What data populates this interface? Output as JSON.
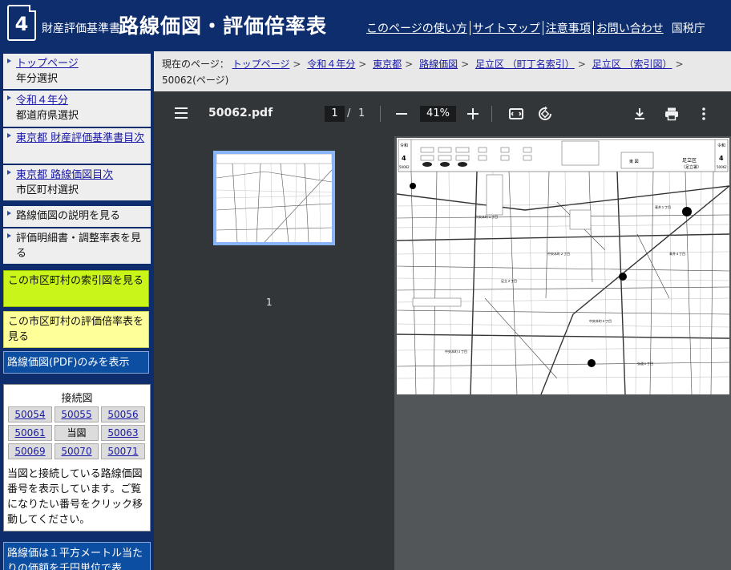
{
  "header": {
    "logo_number": "4",
    "subtitle": "財産評価基準書",
    "title": "路線価図・評価倍率表",
    "nav": [
      "このページの使い方",
      "サイトマップ",
      "注意事項",
      "お問い合わせ"
    ],
    "agency": "国税庁"
  },
  "sidebar": {
    "items": [
      {
        "link": "トップページ",
        "sub": "年分選択"
      },
      {
        "link": "令和４年分",
        "sub": "都道府県選択"
      },
      {
        "link": "東京都 財産評価基準書目次",
        "sub": ""
      },
      {
        "link": "東京都 路線価図目次",
        "sub": "市区町村選択"
      },
      {
        "text": "路線価図の説明を見る"
      },
      {
        "text": "評価明細書・調整率表を見る"
      }
    ],
    "index_map": "この市区町村の索引図を見る",
    "rate_table": "この市区町村の評価倍率表を見る",
    "pdf_only": "路線価図(PDF)のみを表示",
    "connect": {
      "title": "接続図",
      "cells": [
        "50054",
        "50055",
        "50056",
        "50061",
        "当図",
        "50063",
        "50069",
        "50070",
        "50071"
      ],
      "description": "当図と接続している路線価図番号を表示しています。ご覧になりたい番号をクリック移動してください。"
    },
    "bottom_note": "路線価は１平方メートル当たりの価額を千円単位で表"
  },
  "breadcrumb": {
    "label": "現在のページ：",
    "items": [
      "トップページ",
      "令和４年分",
      "東京都",
      "路線価図",
      "足立区 （町丁名索引）",
      "足立区 （索引図）"
    ],
    "current": "50062(ページ)"
  },
  "viewer": {
    "filename": "50062.pdf",
    "current_page": "1",
    "page_sep": "/",
    "total_pages": "1",
    "zoom": "41%",
    "thumbnail_label": "1",
    "icons": [
      "menu-icon",
      "zoom-out-icon",
      "zoom-in-icon",
      "fit-page-icon",
      "rotate-icon",
      "download-icon",
      "print-icon",
      "more-vert-icon"
    ]
  },
  "map": {
    "left_label_top": "令和",
    "left_label_num": "4",
    "left_label_code": "50062",
    "right_label_top": "令和",
    "right_label_num": "4",
    "right_label_code": "50062",
    "ward": "足立区",
    "ward_sub": "（足立署）",
    "direction_box": "東 図",
    "areas": [
      "中央本町１丁目",
      "中央本町２丁目",
      "中央本町３丁目",
      "中央本町４丁目",
      "青井１丁目",
      "青井４丁目",
      "弘道１丁目",
      "足立２丁目"
    ]
  }
}
